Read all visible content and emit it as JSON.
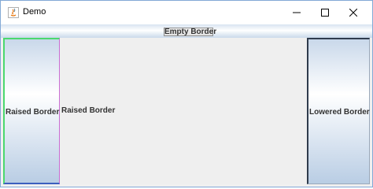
{
  "window": {
    "title": "Demo",
    "app_icon": "java-icon",
    "controls": {
      "minimize": "minimize-icon",
      "maximize": "maximize-icon",
      "close": "close-icon"
    }
  },
  "north": {
    "button_label": "Empty Border"
  },
  "west": {
    "label": "Raised Border"
  },
  "center": {
    "label": "Raised Border"
  },
  "east": {
    "label": "Lowered Border"
  },
  "colors": {
    "window_border": "#83a9d6",
    "panel_gradient_mid": "#ffffff",
    "panel_gradient_edge": "#c9d8ea",
    "raised_highlight": "#4bd86e",
    "raised_shadow": "#3c5fbe",
    "raised_accent": "#c96ed2",
    "lowered_shadow": "#2f3b4c",
    "center_bg": "#efefef"
  }
}
